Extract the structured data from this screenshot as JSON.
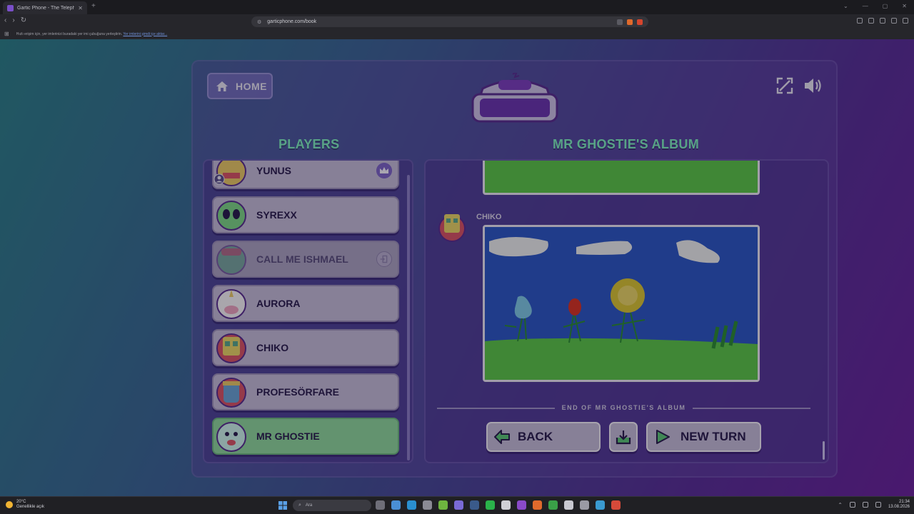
{
  "browser": {
    "tab_title": "Gartic Phone - The Telephone Ga",
    "url": "garticphone.com/book",
    "bookmarks_text": "Hızlı erişim için, yer imlerinizi buradaki yer imi çubuğuna yerleştirin.",
    "bookmarks_link": "Yer imlerini şimdi içe aktar..."
  },
  "game": {
    "home_label": "HOME",
    "players_title": "PLAYERS",
    "album_title": "MR GHOSTIE'S ALBUM",
    "players": [
      {
        "name": "YUNUS",
        "badge": "crown-icon"
      },
      {
        "name": "SYREXX",
        "badge": ""
      },
      {
        "name": "CALL ME ISHMAEL",
        "badge": "exit-icon"
      },
      {
        "name": "AURORA",
        "badge": ""
      },
      {
        "name": "CHIKO",
        "badge": ""
      },
      {
        "name": "PROFESÖRFARE",
        "badge": ""
      },
      {
        "name": "MR GHOSTIE",
        "badge": ""
      }
    ],
    "active_player": "MR GHOSTIE",
    "album_entry_author": "CHIKO",
    "end_text": "END OF MR GHOSTIE'S ALBUM",
    "back_label": "BACK",
    "new_turn_label": "NEW TURN"
  },
  "taskbar": {
    "temp": "20°C",
    "weather_desc": "Genellikle açık",
    "search_placeholder": "Ara",
    "time": "21:34",
    "date": "13.08.2026"
  },
  "colors": {
    "accent_green": "#7ee8c0",
    "card_bg": "#c2b8d8",
    "active_card_bg": "#8fd3a0",
    "drawing_sky": "#2f56c6",
    "drawing_grass": "#5cc24e"
  }
}
